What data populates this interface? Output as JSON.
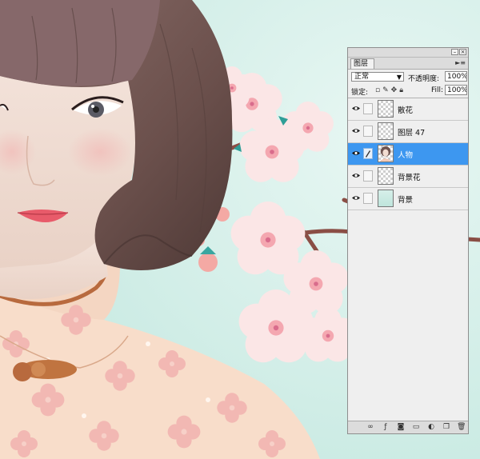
{
  "panel": {
    "title": "图层",
    "blend_mode": "正常",
    "opacity_label": "不透明度:",
    "opacity_value": "100%",
    "lock_label": "锁定:",
    "fill_label": "Fill:",
    "fill_value": "100%",
    "layers": [
      {
        "name": "散花",
        "visible": true,
        "selected": false,
        "thumb": "transparent"
      },
      {
        "name": "图层 47",
        "visible": true,
        "selected": false,
        "thumb": "transparent"
      },
      {
        "name": "人物",
        "visible": true,
        "selected": true,
        "thumb": "portrait"
      },
      {
        "name": "背景花",
        "visible": true,
        "selected": false,
        "thumb": "transparent"
      },
      {
        "name": "背景",
        "visible": true,
        "selected": false,
        "thumb": "mint-gradient"
      }
    ],
    "bottom_icons": [
      "link-layers-icon",
      "layer-style-icon",
      "layer-mask-icon",
      "new-group-icon",
      "adjustment-layer-icon",
      "new-layer-icon",
      "delete-layer-icon"
    ]
  },
  "colors": {
    "background": "#cfeee7",
    "selection": "#3d97f0",
    "hair": "#6e5450",
    "dress": "#f7dccb",
    "blossom": "#f7d6d6",
    "branch": "#8a4e45"
  }
}
